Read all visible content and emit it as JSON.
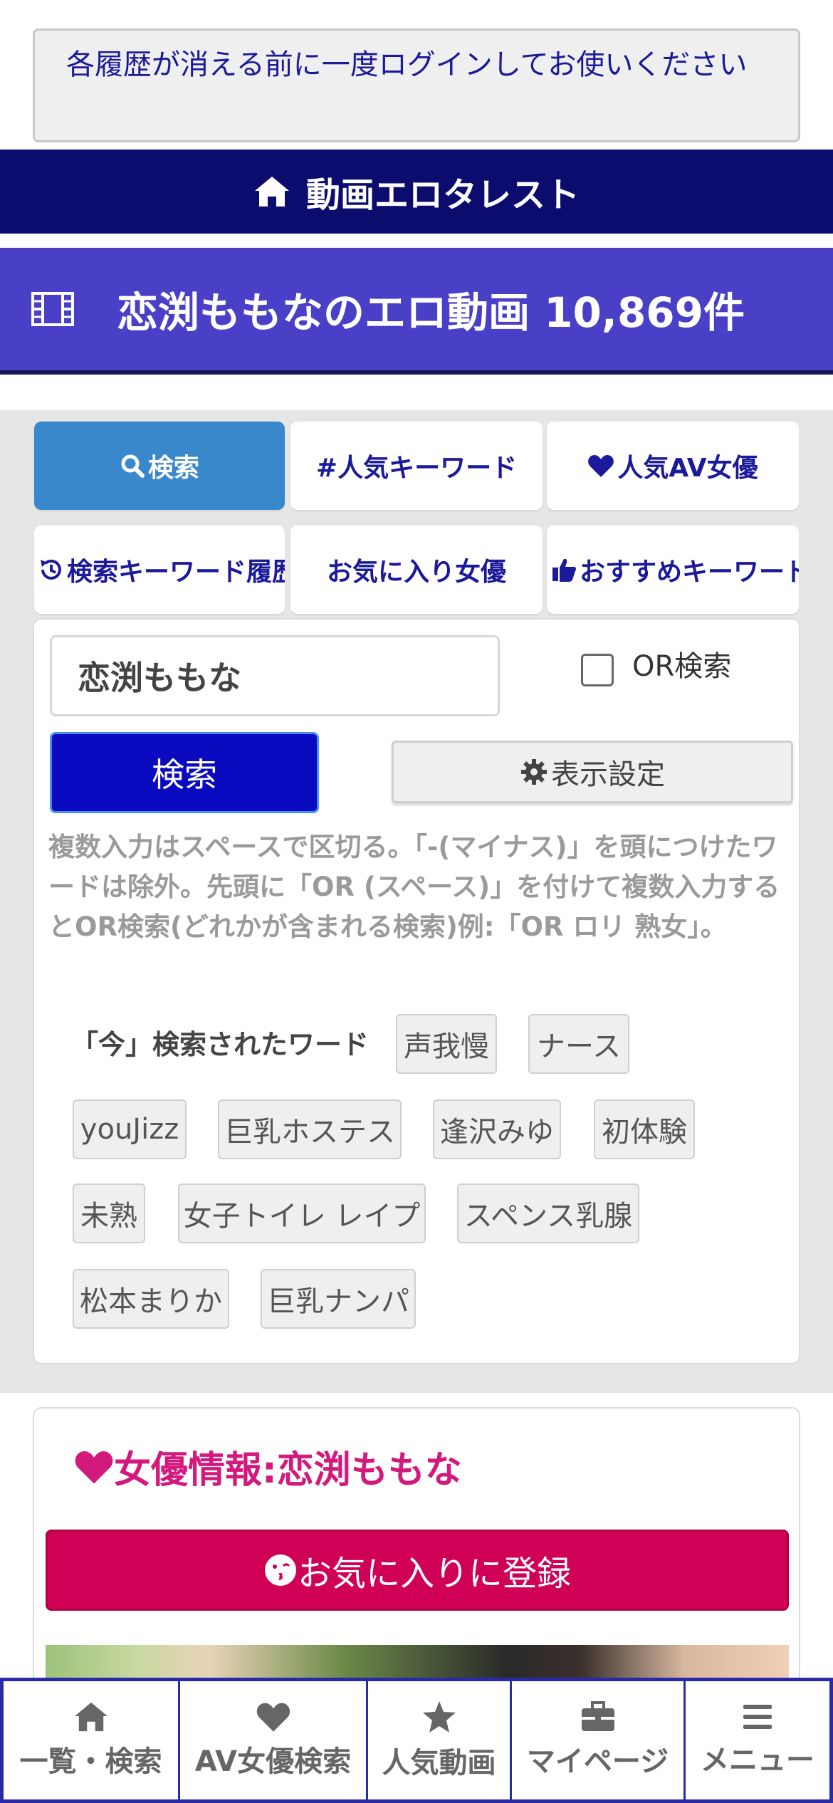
{
  "notice": {
    "text": "各履歴が消える前に一度ログインしてお使いください"
  },
  "header": {
    "site_name": "動画エロタレスト",
    "icon": "home-icon"
  },
  "page_title": {
    "text": "恋渕ももなのエロ動画 10,869件",
    "icon": "film-icon"
  },
  "tabs": [
    {
      "label": "検索",
      "icon": "search-icon",
      "active": true
    },
    {
      "label": "#人気キーワード",
      "icon": "",
      "active": false
    },
    {
      "label": "人気AV女優",
      "icon": "heart-icon",
      "active": false
    },
    {
      "label": "検索キーワード履歴",
      "icon": "history-icon",
      "active": false
    },
    {
      "label": "お気に入り女優",
      "icon": "",
      "active": false
    },
    {
      "label": "おすすめキーワード",
      "icon": "thumbs-up-icon",
      "active": false
    }
  ],
  "search": {
    "value": "恋渕ももな",
    "or_label": "OR検索",
    "or_checked": false,
    "submit_label": "検索",
    "display_settings_label": "表示設定",
    "help": "複数入力はスペースで区切る。「-(マイナス)」を頭につけたワードは除外。先頭に「OR (スペース)」を付けて複数入力するとOR検索(どれかが含まれる検索)例:「OR ロリ 熟女」。"
  },
  "recent": {
    "label": "「今」検索されたワード",
    "words": [
      "声我慢",
      "ナース",
      "youJizz",
      "巨乳ホステス",
      "逢沢みゆ",
      "初体験",
      "未熟",
      "女子トイレ レイプ",
      "スペンス乳腺",
      "松本まりか",
      "巨乳ナンパ"
    ]
  },
  "actress": {
    "title": "女優情報:恋渕ももな",
    "favorite_label": "お気に入りに登録"
  },
  "bottom_nav": [
    {
      "label": "一覧・検索",
      "icon": "home-icon"
    },
    {
      "label": "AV女優検索",
      "icon": "heart-icon"
    },
    {
      "label": "人気動画",
      "icon": "star-icon"
    },
    {
      "label": "マイページ",
      "icon": "briefcase-icon"
    },
    {
      "label": "メニュー",
      "icon": "menu-icon"
    }
  ],
  "colors": {
    "header_bg": "#0c0c6e",
    "title_bg": "#4a40c8",
    "active_tab": "#3a88cc",
    "search_button": "#0a0ac0",
    "favorite_button": "#d10057",
    "actress_title": "#d4197c"
  }
}
